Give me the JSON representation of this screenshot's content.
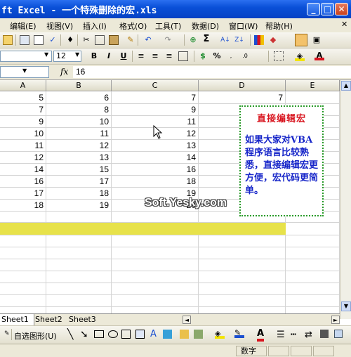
{
  "window": {
    "title": "ft Excel - 一个特殊删除的宏.xls"
  },
  "menus": [
    {
      "label": "编辑(E)"
    },
    {
      "label": "视图(V)"
    },
    {
      "label": "插入(I)"
    },
    {
      "label": "格式(O)"
    },
    {
      "label": "工具(T)"
    },
    {
      "label": "数据(D)"
    },
    {
      "label": "窗口(W)"
    },
    {
      "label": "帮助(H)"
    }
  ],
  "format_toolbar": {
    "font_size": "12",
    "bold": "B",
    "italic": "I",
    "underline": "U",
    "percent": "%"
  },
  "formula_bar": {
    "fx": "fx",
    "value": "16"
  },
  "columns": [
    "A",
    "B",
    "C",
    "D",
    "E"
  ],
  "rows": [
    [
      "5",
      "6",
      "7",
      "7"
    ],
    [
      "7",
      "8",
      "9",
      ""
    ],
    [
      "9",
      "10",
      "11",
      ""
    ],
    [
      "10",
      "11",
      "12",
      ""
    ],
    [
      "11",
      "12",
      "13",
      ""
    ],
    [
      "12",
      "13",
      "14",
      ""
    ],
    [
      "14",
      "15",
      "16",
      ""
    ],
    [
      "16",
      "17",
      "18",
      ""
    ],
    [
      "17",
      "18",
      "19",
      ""
    ],
    [
      "18",
      "19",
      "20",
      ""
    ]
  ],
  "highlight_color": "#e7e24a",
  "textbox": {
    "title": "直接编辑宏",
    "body": "如果大家对VBA程序语言比较熟悉，直接编辑宏更方便，宏代码更简单。",
    "title_color": "#d8141e",
    "body_color": "#1726c9",
    "border_color": "#2a9b2a"
  },
  "watermark": "Soft.Yesky.com",
  "sheets": [
    {
      "label": "Sheet1"
    },
    {
      "label": "Sheet2"
    },
    {
      "label": "Sheet3"
    }
  ],
  "drawing_toolbar": {
    "autoshapes": "自选图形(U)"
  },
  "status": {
    "mode": "数字"
  }
}
